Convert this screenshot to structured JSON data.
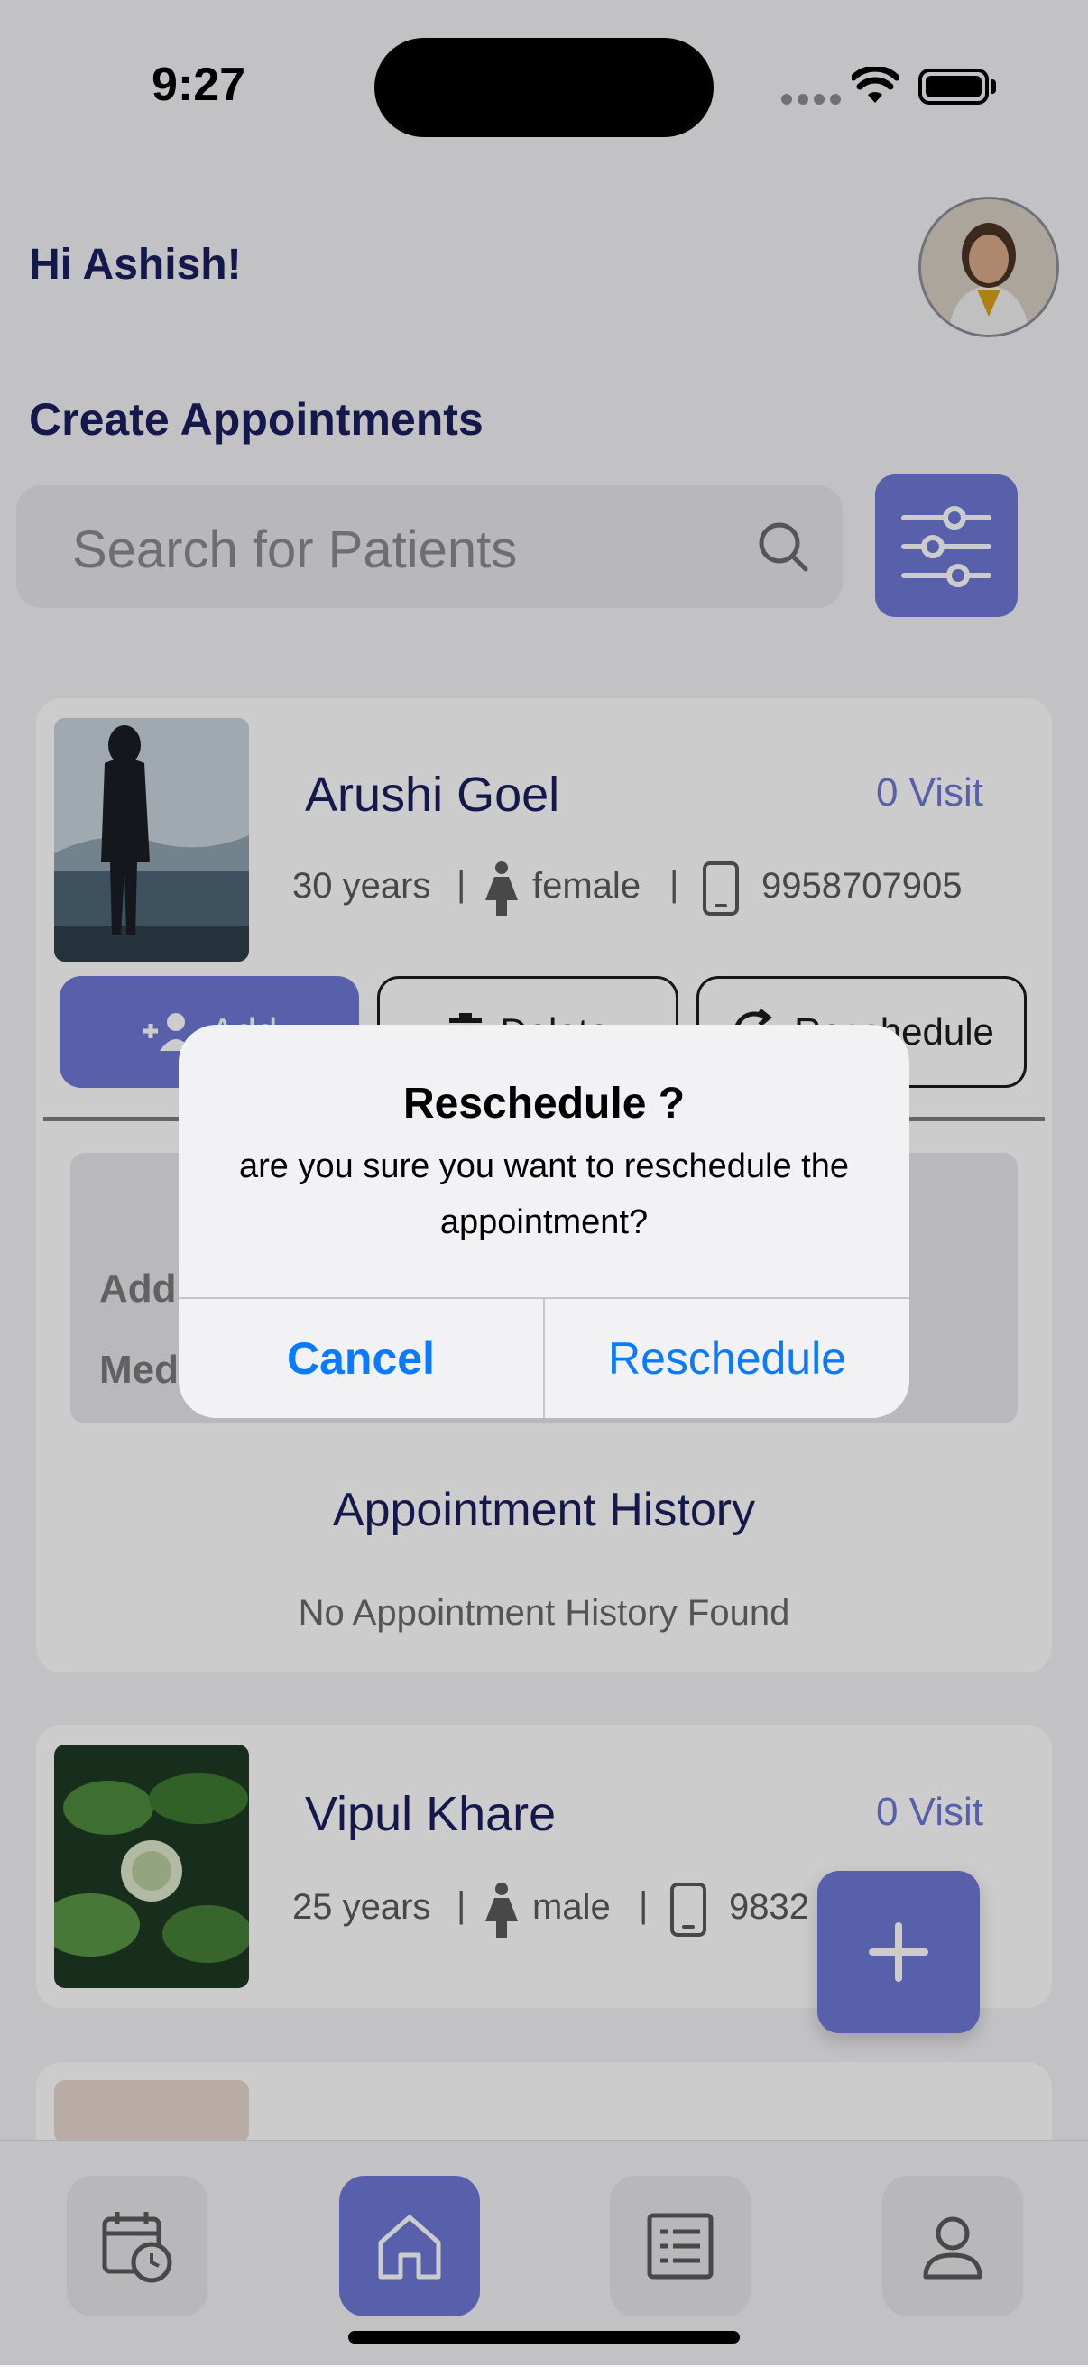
{
  "status_bar": {
    "time": "9:27"
  },
  "header": {
    "greeting": "Hi Ashish!",
    "section_title": "Create Appointments"
  },
  "search": {
    "placeholder": "Search for Patients"
  },
  "patients": [
    {
      "name": "Arushi  Goel",
      "visits": "0 Visit",
      "age": "30 years",
      "gender": "female",
      "phone": "9958707905",
      "actions": {
        "add": "Add",
        "delete": "Delete",
        "reschedule": "Reschedule"
      },
      "inner_labels": [
        "Add",
        "Med"
      ],
      "history_title": "Appointment History",
      "history_empty": "No Appointment History Found"
    },
    {
      "name": "Vipul  Khare",
      "visits": "0 Visit",
      "age": "25 years",
      "gender": "male",
      "phone": "9832"
    }
  ],
  "alert": {
    "title": "Reschedule ?",
    "message": "are you sure you want to reschedule the appointment?",
    "cancel": "Cancel",
    "confirm": "Reschedule"
  },
  "colors": {
    "accent": "#6e78d8",
    "primary_text": "#1b1f5e",
    "ios_blue": "#0a7aff"
  },
  "tabbar": {
    "active": "home",
    "tabs": [
      "calendar-clock-icon",
      "home-icon",
      "list-icon",
      "profile-icon"
    ]
  }
}
